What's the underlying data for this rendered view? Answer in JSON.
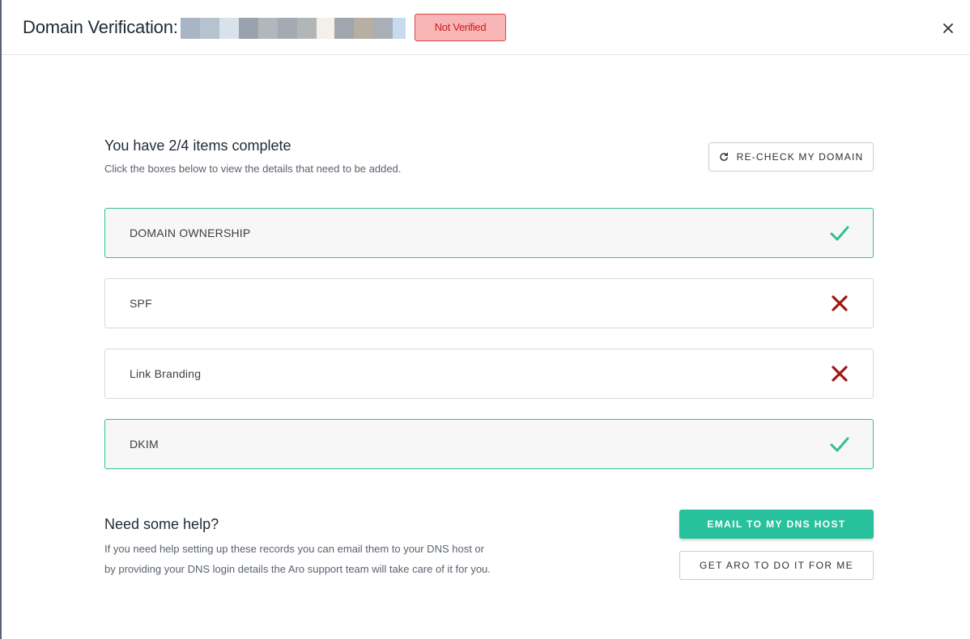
{
  "header": {
    "title": "Domain Verification:",
    "status_badge": "Not Verified",
    "close_icon": "close-icon"
  },
  "progress": {
    "title": "You have 2/4 items complete",
    "subtitle": "Click the boxes below to view the details that need to be added.",
    "recheck_label": "RE-CHECK MY DOMAIN",
    "recheck_icon": "refresh-icon"
  },
  "items": [
    {
      "label": "DOMAIN OWNERSHIP",
      "status": "complete",
      "icon": "check-icon"
    },
    {
      "label": "SPF",
      "status": "incomplete",
      "icon": "cross-icon"
    },
    {
      "label": "Link Branding",
      "status": "incomplete",
      "icon": "cross-icon"
    },
    {
      "label": "DKIM",
      "status": "complete",
      "icon": "check-icon"
    }
  ],
  "help": {
    "title": "Need some help?",
    "text": "If you need help setting up these records you can email them to your DNS host or by providing your DNS login details the Aro support team will take care of it for you.",
    "email_button": "EMAIL TO MY DNS HOST",
    "aro_button": "GET ARO TO DO IT FOR ME"
  },
  "colors": {
    "accent_green": "#27c29b",
    "complete_border": "#34bf93",
    "error_red": "#a01818",
    "badge_bg": "#f8b5b5",
    "badge_text": "#d01a1a"
  }
}
